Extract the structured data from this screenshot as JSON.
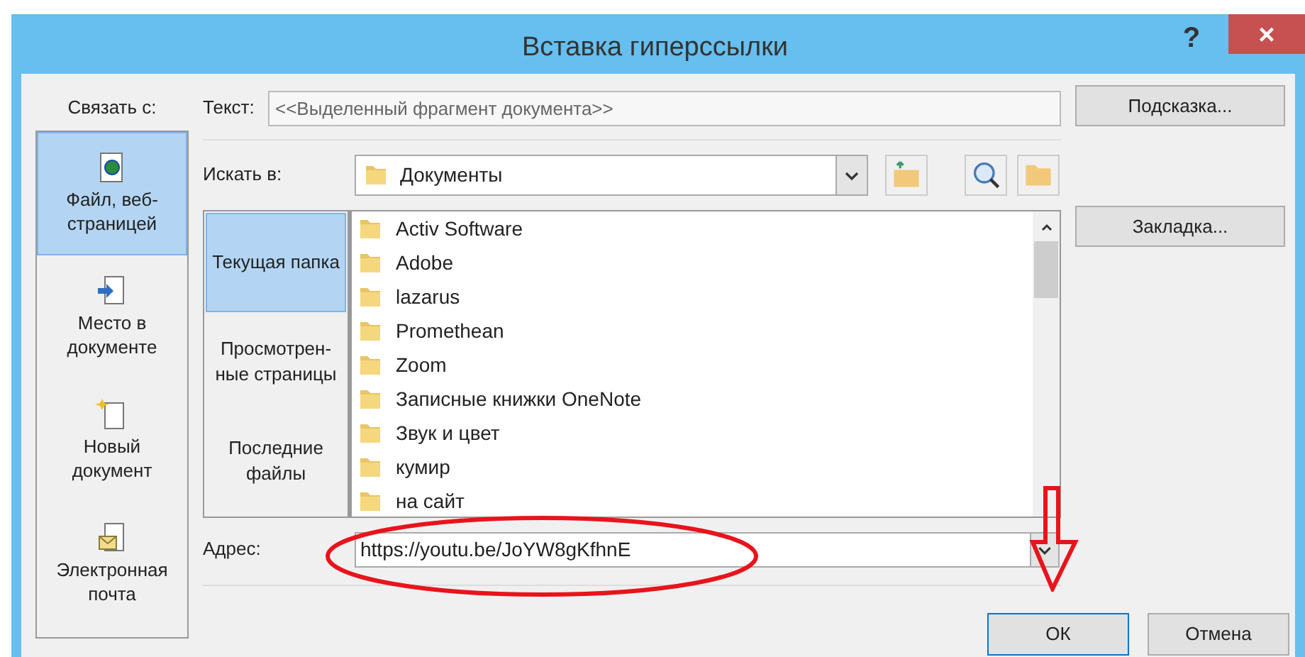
{
  "window": {
    "title": "Вставка гиперссылки",
    "help": "?",
    "close": "×"
  },
  "link_to": {
    "label": "Связать с:",
    "items": [
      {
        "label": "Файл, веб-страницей",
        "kind": "web",
        "selected": true
      },
      {
        "label": "Место в документе",
        "kind": "place",
        "selected": false
      },
      {
        "label": "Новый документ",
        "kind": "new",
        "selected": false
      },
      {
        "label": "Электронная почта",
        "kind": "mail",
        "selected": false
      }
    ]
  },
  "text_field": {
    "label": "Текст:",
    "value": "<<Выделенный фрагмент документа>>"
  },
  "hint_button": "Подсказка...",
  "look_in": {
    "label": "Искать в:",
    "value": "Документы"
  },
  "nav": [
    {
      "label": "Текущая папка",
      "selected": true
    },
    {
      "label": "Просмотрен-ные страницы",
      "selected": false
    },
    {
      "label": "Последние файлы",
      "selected": false
    }
  ],
  "files": [
    "Activ Software",
    "Adobe",
    "lazarus",
    "Promethean",
    "Zoom",
    "Записные книжки OneNote",
    "Звук и цвет",
    "кумир",
    "на сайт"
  ],
  "bookmark_button": "Закладка...",
  "address": {
    "label": "Адрес:",
    "value": "https://youtu.be/JoYW8gKfhnE"
  },
  "buttons": [
    {
      "label": "ОК",
      "selected": true
    },
    {
      "label": "Отмена",
      "selected": false
    }
  ]
}
